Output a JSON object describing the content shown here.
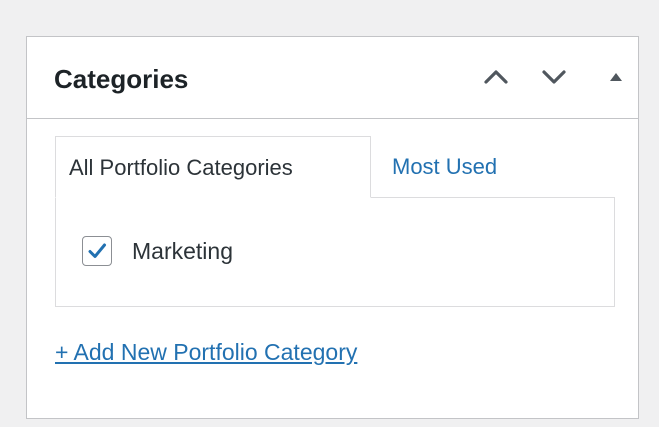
{
  "panel": {
    "title": "Categories",
    "controls": {
      "move_up_icon": "chevron-up-icon",
      "move_down_icon": "chevron-down-icon",
      "toggle_icon": "triangle-up-icon"
    }
  },
  "tabs": [
    {
      "label": "All Portfolio Categories",
      "active": true
    },
    {
      "label": "Most Used",
      "active": false
    }
  ],
  "categories": [
    {
      "label": "Marketing",
      "checked": true
    }
  ],
  "add_link": "+ Add New Portfolio Category",
  "colors": {
    "link": "#2271b1",
    "text": "#1d2327",
    "border": "#c3c4c7",
    "background": "#f0f0f1"
  }
}
